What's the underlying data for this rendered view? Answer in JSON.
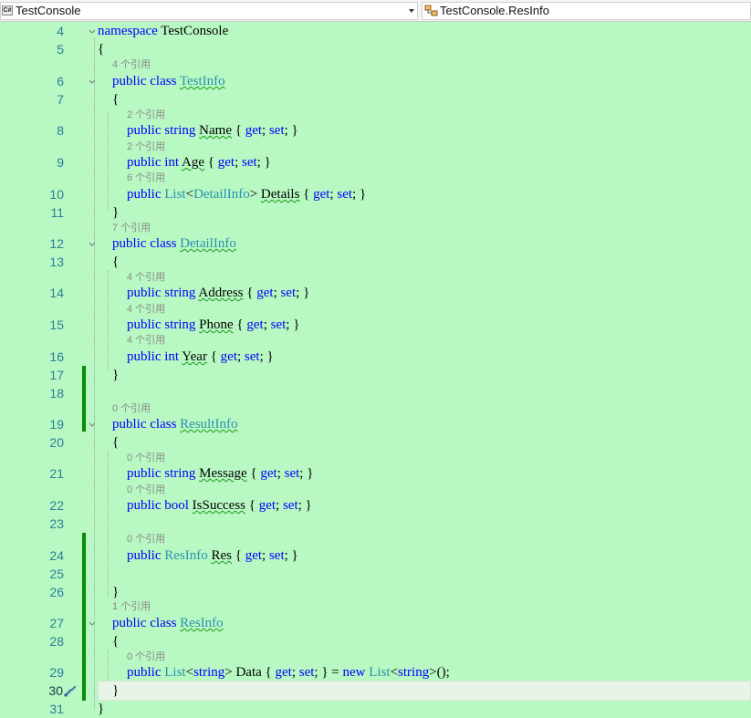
{
  "navigation": {
    "project_dropdown": {
      "icon": "csharp-project-icon",
      "icon_text": "C#",
      "value": "TestConsole"
    },
    "member_dropdown": {
      "icon": "class-icon",
      "value": "TestConsole.ResInfo"
    }
  },
  "colors": {
    "background": "#b8f8c2",
    "keyword": "#0000ff",
    "type": "#2b91af",
    "line_number": "#2b7f9a",
    "change_marker": "#0a8a0a",
    "codelens": "#8a8a8a"
  },
  "editor": {
    "current_line": "30",
    "line_numbers": [
      "4",
      "5",
      "6",
      "7",
      "8",
      "9",
      "10",
      "11",
      "12",
      "13",
      "14",
      "15",
      "16",
      "17",
      "18",
      "19",
      "20",
      "21",
      "22",
      "23",
      "24",
      "25",
      "26",
      "27",
      "28",
      "29",
      "30",
      "31"
    ],
    "codelens": [
      "4 个引用",
      "2 个引用",
      "2 个引用",
      "6 个引用",
      "7 个引用",
      "4 个引用",
      "4 个引用",
      "4 个引用",
      "0 个引用",
      "0 个引用",
      "0 个引用",
      "0 个引用",
      "1 个引用",
      "0 个引用"
    ],
    "tokens": {
      "namespace_kw": "namespace",
      "namespace_name": "TestConsole",
      "open_brace": "{",
      "close_brace": "}",
      "public_kw": "public",
      "class_kw": "class",
      "string_kw": "string",
      "int_kw": "int",
      "bool_kw": "bool",
      "new_kw": "new",
      "accessors": "{ get; set; }",
      "get_kw": "get",
      "set_kw": "set",
      "class_testinfo": "TestInfo",
      "class_detailinfo": "DetailInfo",
      "class_resultinfo": "ResultInfo",
      "class_resinfo": "ResInfo",
      "list_type": "List",
      "prop_name": "Name",
      "prop_age": "Age",
      "prop_details": "Details",
      "prop_address": "Address",
      "prop_phone": "Phone",
      "prop_year": "Year",
      "prop_message": "Message",
      "prop_issuccess": "IsSuccess",
      "prop_res": "Res",
      "prop_data": "Data"
    }
  }
}
